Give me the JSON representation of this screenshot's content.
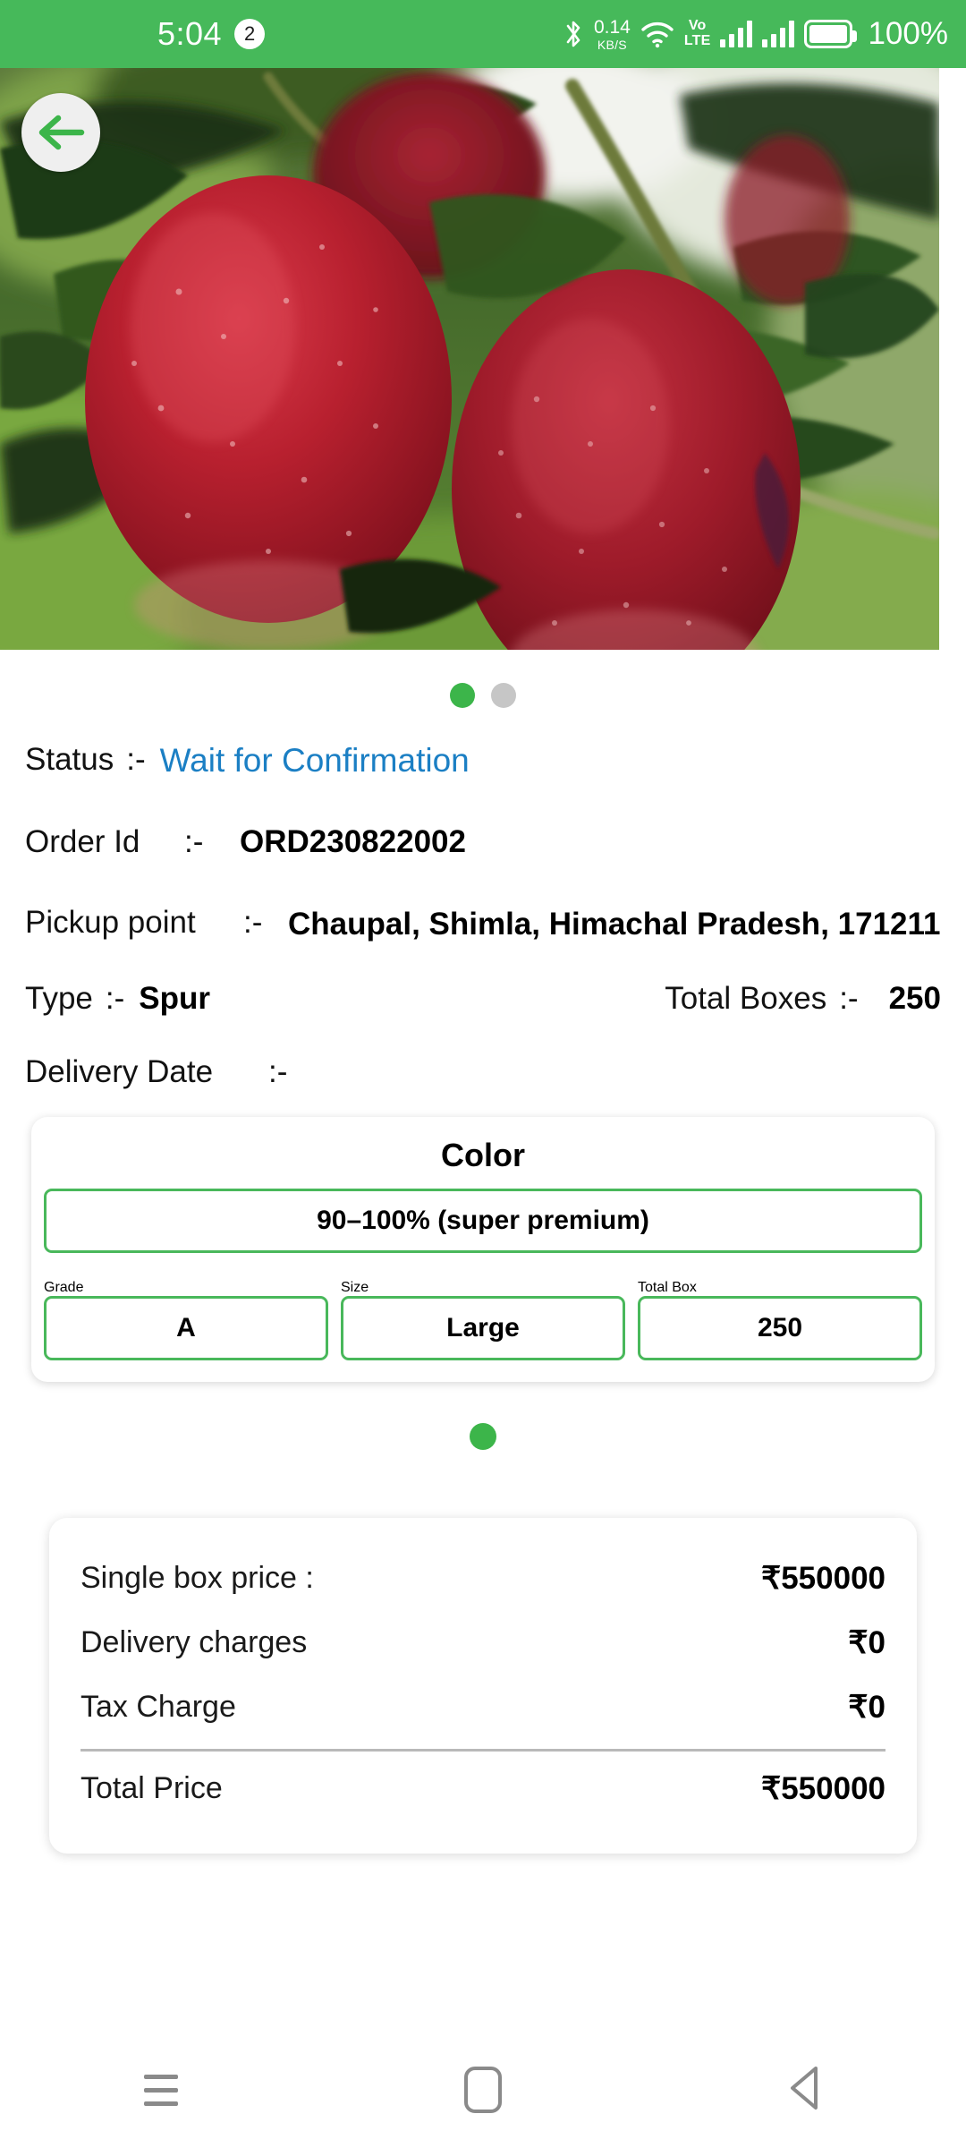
{
  "statusbar": {
    "time": "5:04",
    "notification_count": "2",
    "bluetooth_icon": "bluetooth-icon",
    "network_speed": "0.14",
    "network_speed_unit": "KB/S",
    "wifi_icon": "wifi-icon",
    "volte_line1": "Vo",
    "volte_line2": "LTE",
    "battery_percent": "100%",
    "bg_color": "#46b95a"
  },
  "hero": {
    "back_icon": "back-arrow-icon",
    "image_alt": "red-apples-on-tree"
  },
  "carousel": {
    "dots": [
      "active",
      "inactive"
    ],
    "active_color": "#3cb54a",
    "inactive_color": "#c6c6c6"
  },
  "order": {
    "status_label": "Status",
    "status_sep": ":-",
    "status_value": "Wait for Confirmation",
    "status_color": "#1b7fc4",
    "order_id_label": "Order Id",
    "order_id_sep": ":-",
    "order_id_value": "ORD230822002",
    "pickup_label": "Pickup point",
    "pickup_sep": ":-",
    "pickup_value": "Chaupal, Shimla, Himachal Pradesh, 171211",
    "type_label": "Type",
    "type_sep": ":-",
    "type_value": "Spur",
    "total_boxes_label": "Total Boxes",
    "total_boxes_sep": ":-",
    "total_boxes_value": "250",
    "delivery_date_label": "Delivery Date",
    "delivery_date_sep": ":-",
    "delivery_date_value": ""
  },
  "grade_card": {
    "color_header": "Color",
    "color_value": "90–100% (super premium)",
    "grade_header": "Grade",
    "size_header": "Size",
    "total_box_header": "Total Box",
    "grade_value": "A",
    "size_value": "Large",
    "total_box_value": "250",
    "border_color": "#49b85b",
    "page_dot": "active"
  },
  "price": {
    "rows": [
      {
        "label": "Single box price :",
        "value": "₹550000"
      },
      {
        "label": "Delivery charges",
        "value": "₹0"
      },
      {
        "label": "Tax Charge",
        "value": "₹0"
      }
    ],
    "total_label": "Total Price",
    "total_value": "₹550000"
  },
  "navbar": {
    "recent_icon": "recents-icon",
    "home_icon": "home-icon",
    "back_icon": "back-triangle-icon"
  }
}
